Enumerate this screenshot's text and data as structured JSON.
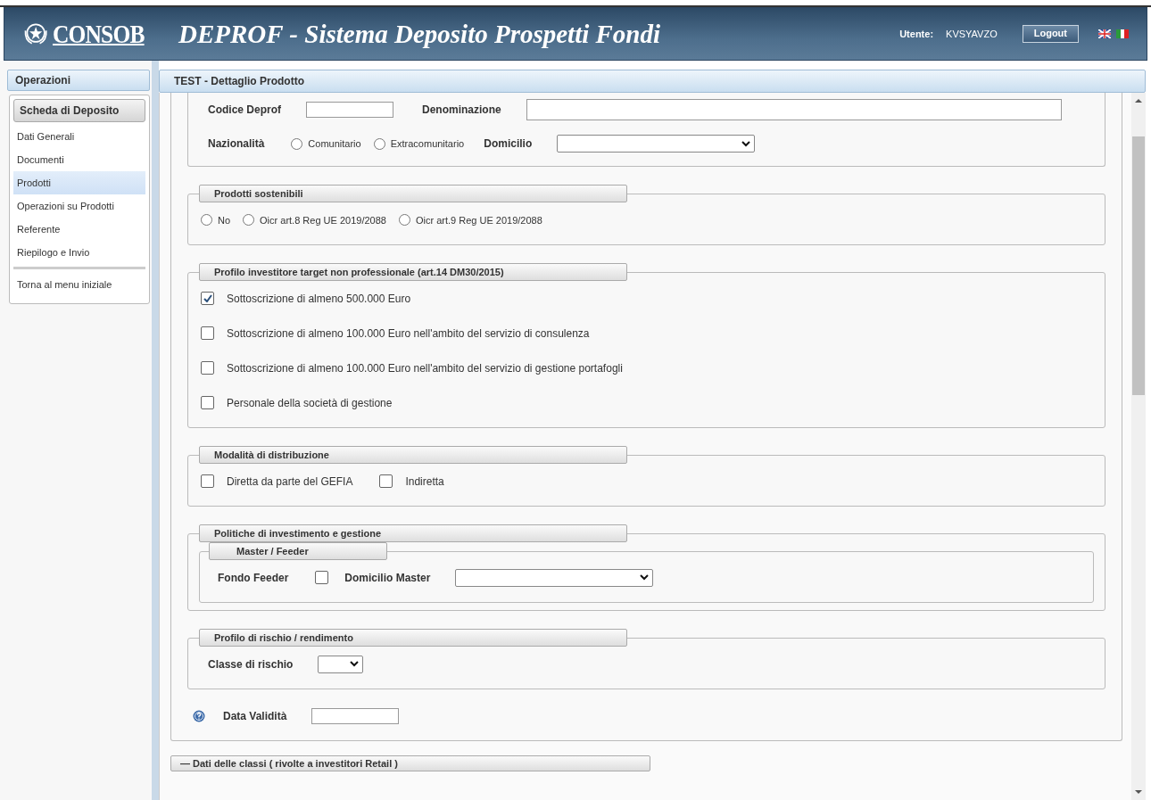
{
  "header": {
    "logo": "CONSOB",
    "title": "DEPROF - Sistema Deposito Prospetti Fondi",
    "user_label": "Utente:",
    "user": "KVSYAVZO",
    "logout": "Logout"
  },
  "sidebar": {
    "title": "Operazioni",
    "section": "Scheda di Deposito",
    "items": [
      {
        "label": "Dati Generali",
        "selected": false
      },
      {
        "label": "Documenti",
        "selected": false
      },
      {
        "label": "Prodotti",
        "selected": true
      },
      {
        "label": "Operazioni su Prodotti",
        "selected": false
      },
      {
        "label": "Referente",
        "selected": false
      },
      {
        "label": "Riepilogo e Invio",
        "selected": false
      }
    ],
    "back": "Torna al menu iniziale"
  },
  "panel": {
    "title": "TEST - Dettaglio Prodotto",
    "sections": [
      {
        "rows": [
          [
            {
              "kind": "label",
              "text": "Codice Deprof"
            },
            {
              "kind": "text-field"
            },
            {
              "kind": "label",
              "text": "Denominazione"
            },
            {
              "kind": "wide-text-field"
            }
          ],
          [
            {
              "kind": "label",
              "text": "Nazionalità"
            },
            {
              "kind": "radio",
              "label": "Comunitario",
              "selected": false
            },
            {
              "kind": "radio",
              "label": "Extracomunitario",
              "selected": false
            },
            {
              "kind": "label",
              "text": "Domicilio"
            },
            {
              "kind": "select"
            }
          ]
        ]
      },
      {
        "legend": "Prodotti sostenibili",
        "rows": [
          [
            {
              "kind": "radio",
              "label": "No",
              "selected": false
            },
            {
              "kind": "radio",
              "label": "Oicr art.8 Reg UE 2019/2088",
              "selected": false
            },
            {
              "kind": "radio",
              "label": "Oicr art.9 Reg UE 2019/2088",
              "selected": false
            }
          ]
        ]
      },
      {
        "legend": "Profilo investitore target non professionale (art.14 DM30/2015)",
        "rows": [
          [
            {
              "kind": "checkbox",
              "label": "Sottoscrizione di almeno 500.000 Euro",
              "checked": true
            }
          ],
          [
            {
              "kind": "checkbox",
              "label": "Sottoscrizione di almeno 100.000 Euro nell'ambito del servizio di consulenza",
              "checked": false
            }
          ],
          [
            {
              "kind": "checkbox",
              "label": "Sottoscrizione di almeno 100.000 Euro nell'ambito del servizio di gestione portafogli",
              "checked": false
            }
          ],
          [
            {
              "kind": "checkbox",
              "label": "Personale della società di gestione",
              "checked": false
            }
          ]
        ]
      },
      {
        "legend": "Modalità di distribuzione",
        "rows": [
          [
            {
              "kind": "checkbox",
              "label": "Diretta da parte del GEFIA",
              "checked": false
            },
            {
              "kind": "checkbox",
              "label": "Indiretta",
              "checked": false
            }
          ]
        ]
      },
      {
        "legend": "Politiche di investimento e gestione",
        "rows": [
          [
            {
              "kind": "subsection",
              "legend": "Master / Feeder",
              "rows": [
                [
                  {
                    "kind": "label",
                    "text": "Fondo Feeder"
                  },
                  {
                    "kind": "checkbox",
                    "checked": false
                  },
                  {
                    "kind": "label",
                    "text": "Domicilio Master"
                  },
                  {
                    "kind": "select"
                  }
                ]
              ]
            }
          ]
        ]
      },
      {
        "legend": "Profilo di rischio / rendimento",
        "rows": [
          [
            {
              "kind": "label",
              "text": "Classe di rischio"
            },
            {
              "kind": "small-select"
            }
          ]
        ]
      }
    ],
    "footer_row": [
      {
        "kind": "help"
      },
      {
        "kind": "label",
        "text": "Data Validità"
      },
      {
        "kind": "text-field"
      }
    ],
    "next_section": "— Dati delle classi ( rivolte a investitori Retail )"
  }
}
